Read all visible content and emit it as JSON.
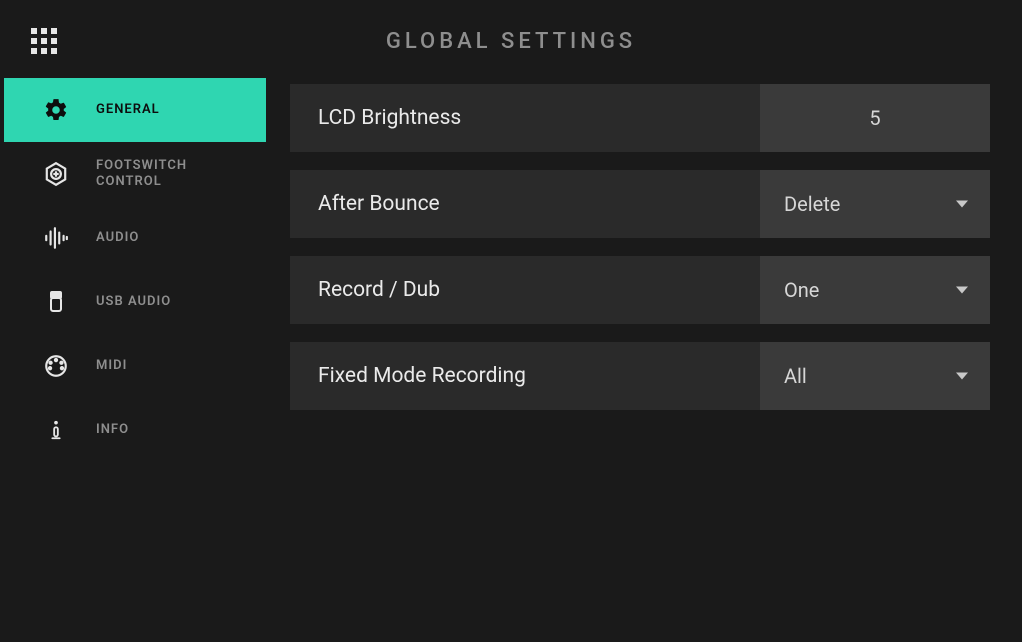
{
  "header": {
    "title": "GLOBAL SETTINGS"
  },
  "sidebar": {
    "items": [
      {
        "label": "GENERAL",
        "icon": "gear",
        "active": true
      },
      {
        "label": "FOOTSWITCH CONTROL",
        "icon": "hexagon-plus",
        "active": false
      },
      {
        "label": "AUDIO",
        "icon": "waveform",
        "active": false
      },
      {
        "label": "USB AUDIO",
        "icon": "usb",
        "active": false
      },
      {
        "label": "MIDI",
        "icon": "midi-connector",
        "active": false
      },
      {
        "label": "INFO",
        "icon": "info",
        "active": false
      }
    ]
  },
  "settings": [
    {
      "label": "LCD Brightness",
      "value": "5",
      "type": "number"
    },
    {
      "label": "After Bounce",
      "value": "Delete",
      "type": "select"
    },
    {
      "label": "Record / Dub",
      "value": "One",
      "type": "select"
    },
    {
      "label": "Fixed Mode Recording",
      "value": "All",
      "type": "select"
    }
  ],
  "colors": {
    "accent": "#2fd6b1",
    "bg": "#1a1a1a",
    "rowBg": "#2a2a2a",
    "valueBg": "#3a3a3a"
  }
}
